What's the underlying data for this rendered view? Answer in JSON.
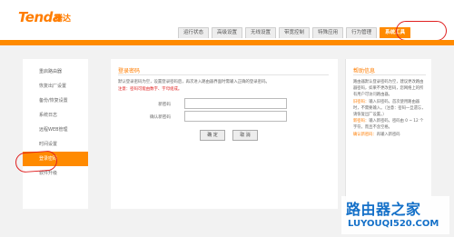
{
  "header": {
    "logo_text": "Tenda",
    "logo_cn": "腾达"
  },
  "tabs": [
    {
      "label": "运行状态",
      "active": false
    },
    {
      "label": "高级设置",
      "active": false
    },
    {
      "label": "无线设置",
      "active": false
    },
    {
      "label": "带宽控制",
      "active": false
    },
    {
      "label": "特殊应用",
      "active": false
    },
    {
      "label": "行为管理",
      "active": false
    },
    {
      "label": "系统工具",
      "active": true
    }
  ],
  "sidebar": {
    "items": [
      {
        "label": "重启路由器",
        "active": false
      },
      {
        "label": "恢复出厂设置",
        "active": false
      },
      {
        "label": "备份/恢复设置",
        "active": false
      },
      {
        "label": "系统日志",
        "active": false
      },
      {
        "label": "远程WEB管理",
        "active": false
      },
      {
        "label": "时间设置",
        "active": false
      },
      {
        "label": "登录密码",
        "active": true
      },
      {
        "label": "软件升级",
        "active": false
      }
    ]
  },
  "main": {
    "title": "登录密码",
    "description": "默认登录密码为空，设置登录密码后，再次进入路由器界面时需输入正确的登录密码。",
    "note": "注意：密码可能由数字、字母组成。",
    "new_password_label": "新密码",
    "confirm_password_label": "确认新密码",
    "new_password_value": "",
    "confirm_password_value": "",
    "ok_button": "确 定",
    "cancel_button": "取 消"
  },
  "help": {
    "title": "帮助信息",
    "text": "路由器默认登录密码为空，建议更改路由器密码，如果不更改密码，您网络上的所有用户可访问路由器。",
    "old_password_label": "旧密码：",
    "old_password_text": "输入旧密码，首次使用路由器时，不需要输入。（注意：密码一旦遗忘，请恢复出厂设置。）",
    "new_password_label": "新密码：",
    "new_password_text": "输入新密码，密码由 0 ~ 12 个字符，而且不含空格。",
    "confirm_label": "确认新密码：",
    "confirm_text": "再输入新密码"
  },
  "watermark": {
    "cn": "路由器之家",
    "url": "LUYOUQI520.COM"
  },
  "colors": {
    "accent": "#ff8a00",
    "warning": "#e02020",
    "watermark": "#1470c8"
  }
}
